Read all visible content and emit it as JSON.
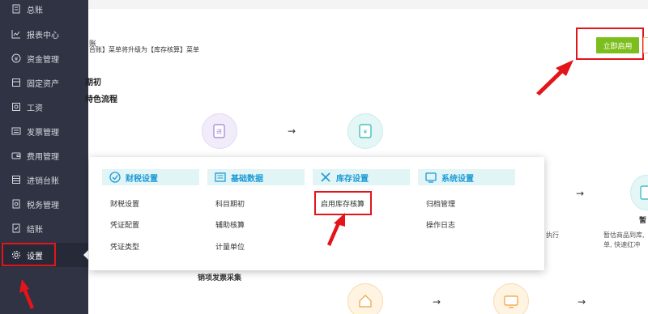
{
  "sidebar": {
    "items": [
      {
        "label": "总账",
        "icon": "ledger-icon"
      },
      {
        "label": "报表中心",
        "icon": "chart-icon"
      },
      {
        "label": "资金管理",
        "icon": "money-icon"
      },
      {
        "label": "固定资产",
        "icon": "asset-icon"
      },
      {
        "label": "工资",
        "icon": "salary-icon"
      },
      {
        "label": "发票管理",
        "icon": "invoice-icon"
      },
      {
        "label": "费用管理",
        "icon": "wallet-icon"
      },
      {
        "label": "进销台账",
        "icon": "inventory-icon"
      },
      {
        "label": "税务管理",
        "icon": "tax-icon"
      },
      {
        "label": "结账",
        "icon": "checkout-icon"
      },
      {
        "label": "设置",
        "icon": "gear-icon"
      }
    ]
  },
  "notice": {
    "text": "台账】菜单将升级为【库存核算】菜单",
    "edge_char": "账"
  },
  "enable_button": {
    "label": "立即启用"
  },
  "flow": {
    "heading1": "期初",
    "heading2": "特色流程",
    "arrow": "→",
    "snippet_tax": "执行",
    "snippet_right1": "暂",
    "snippet_right2": "暂估商品到库,",
    "snippet_right3": "单, 快速红冲",
    "snippet_sales": "销项发票采集"
  },
  "popup": {
    "columns": [
      {
        "title": "财税设置",
        "icon": "tax-settings-icon",
        "items": [
          "财税设置",
          "凭证配置",
          "凭证类型"
        ]
      },
      {
        "title": "基础数据",
        "icon": "basic-data-icon",
        "items": [
          "科目期初",
          "辅助核算",
          "计量单位"
        ]
      },
      {
        "title": "库存设置",
        "icon": "tools-icon",
        "items": [
          "启用库存核算"
        ]
      },
      {
        "title": "系统设置",
        "icon": "system-icon",
        "items": [
          "归档管理",
          "操作日志"
        ]
      }
    ]
  }
}
